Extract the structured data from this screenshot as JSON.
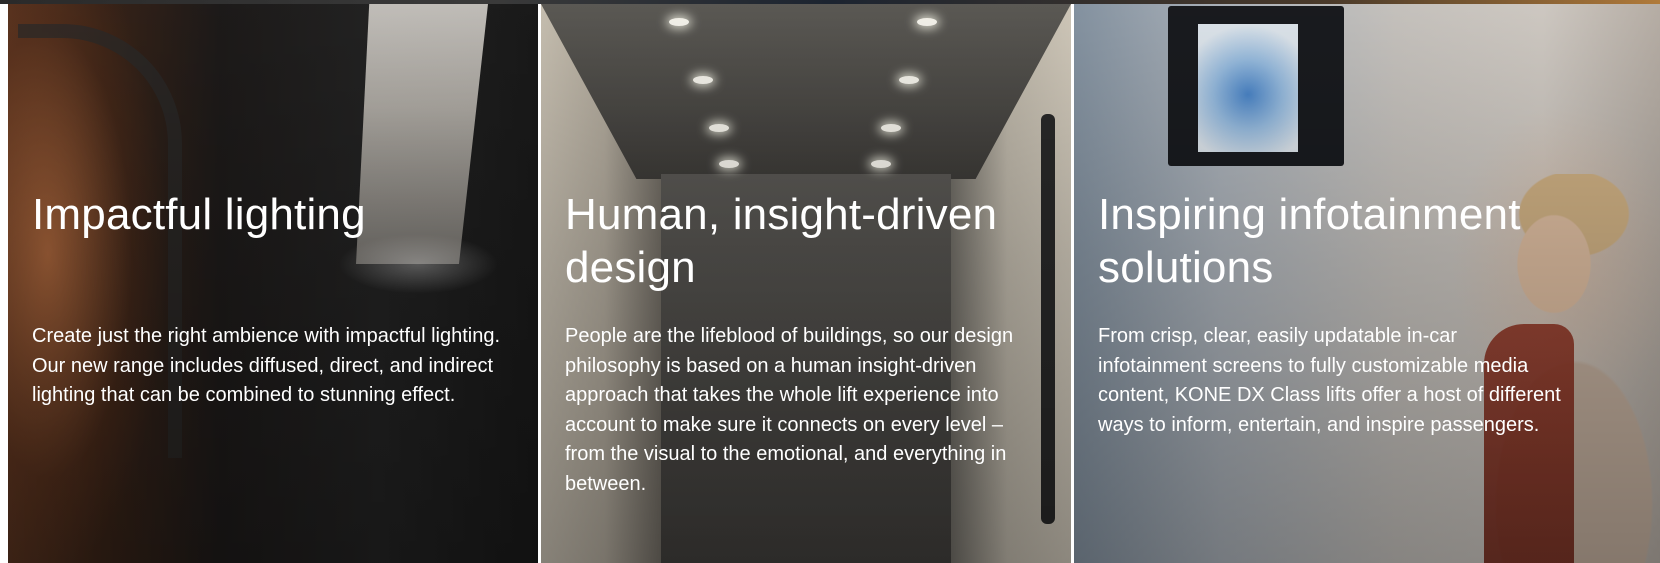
{
  "cards": [
    {
      "title": "Impactful lighting",
      "text": "Create just the right ambience with impactful lighting. Our new range includes diffused, direct, and indirect lighting that can be combined to stunning effect."
    },
    {
      "title": "Human, insight-driven design",
      "text": "People are the lifeblood of buildings, so our design philosophy is based on a human insight-driven approach that takes the whole lift experience into account to make sure it connects on every level – from the visual to the emotional, and everything in between."
    },
    {
      "title": "Inspiring infotainment solutions",
      "text": "From crisp, clear, easily updatable in-car infotainment screens to fully customizable media content, KONE DX Class lifts offer a host of different ways to inform, entertain, and inspire passengers."
    }
  ],
  "colors": {
    "text": "#ffffff",
    "divider": "#ffffff"
  }
}
